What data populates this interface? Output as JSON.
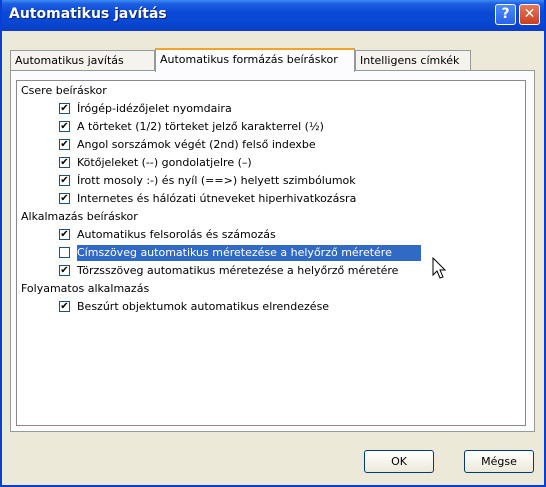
{
  "window": {
    "title": "Automatikus javítás",
    "help_glyph": "?",
    "close_glyph": "✕"
  },
  "tabs": [
    {
      "label": "Automatikus javítás",
      "active": false
    },
    {
      "label": "Automatikus formázás beíráskor",
      "active": true
    },
    {
      "label": "Intelligens címkék",
      "active": false
    }
  ],
  "groups": {
    "replace": {
      "label": "Csere beíráskor",
      "options": [
        {
          "label": "Írógép-idézőjelet nyomdaira",
          "checked": true
        },
        {
          "label": "A törteket (1/2) törteket jelző karakterrel (½)",
          "checked": true
        },
        {
          "label": "Angol sorszámok végét (2nd) felső indexbe",
          "checked": true
        },
        {
          "label": "Kötőjeleket (--) gondolatjelre (–)",
          "checked": true
        },
        {
          "label": "Írott mosoly :-) és nyíl (==>) helyett szimbólumok",
          "checked": true
        },
        {
          "label": "Internetes és hálózati útneveket hiperhivatkozásra",
          "checked": true
        }
      ]
    },
    "apply": {
      "label": "Alkalmazás beíráskor",
      "options": [
        {
          "label": "Automatikus felsorolás és számozás",
          "checked": true
        },
        {
          "label": "Címszöveg automatikus méretezése a helyőrző méretére",
          "checked": false,
          "highlighted": true
        },
        {
          "label": "Törzsszöveg automatikus méretezése a helyőrző méretére",
          "checked": true
        }
      ]
    },
    "continuous": {
      "label": "Folyamatos alkalmazás",
      "options": [
        {
          "label": "Beszúrt objektumok automatikus elrendezése",
          "checked": true
        }
      ]
    }
  },
  "buttons": {
    "ok": "OK",
    "cancel": "Mégse"
  }
}
